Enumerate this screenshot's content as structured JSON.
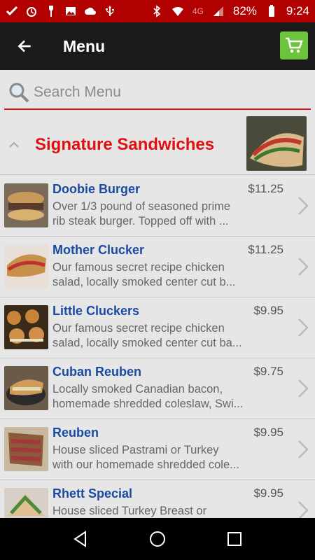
{
  "status_bar": {
    "battery": "82%",
    "time": "9:24",
    "network": "4G",
    "left_icons": [
      "check-icon",
      "alarm-icon",
      "flashlight-icon",
      "image-icon",
      "cloud-icon",
      "usb-icon"
    ],
    "right_icons": [
      "bluetooth-icon",
      "wifi-icon",
      "signal-icon",
      "battery-icon"
    ]
  },
  "app_bar": {
    "title": "Menu",
    "cart_color": "#6cc43a"
  },
  "search": {
    "placeholder": "Search Menu"
  },
  "category": {
    "title": "Signature Sandwiches",
    "title_color": "#e01010"
  },
  "items": [
    {
      "name": "Doobie Burger",
      "price": "$11.25",
      "desc1": "Over 1/3 pound of seasoned prime",
      "desc2": "rib steak burger. Topped off with ..."
    },
    {
      "name": "Mother Clucker",
      "price": "$11.25",
      "desc1": "Our famous secret recipe chicken",
      "desc2": "salad, locally smoked center cut b..."
    },
    {
      "name": "Little Cluckers",
      "price": "$9.95",
      "desc1": "Our famous secret recipe chicken",
      "desc2": "salad, locally smoked center cut ba..."
    },
    {
      "name": "Cuban Reuben",
      "price": "$9.75",
      "desc1": "Locally smoked Canadian bacon,",
      "desc2": "homemade shredded coleslaw, Swi..."
    },
    {
      "name": "Reuben",
      "price": "$9.95",
      "desc1": "House sliced Pastrami or Turkey",
      "desc2": "with our homemade shredded cole..."
    },
    {
      "name": "Rhett Special",
      "price": "$9.95",
      "desc1": "House sliced Turkey Breast or",
      "desc2": ""
    }
  ],
  "colors": {
    "status_bar": "#b00000",
    "app_bar": "#1a1a1a",
    "item_name": "#1a4aa0",
    "accent_line": "#dd1111"
  }
}
